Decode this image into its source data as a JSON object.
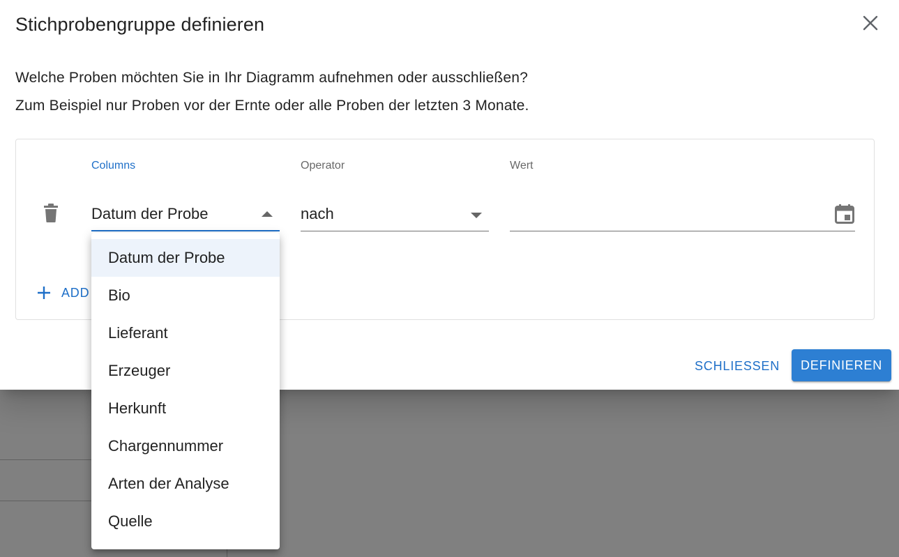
{
  "dialog": {
    "title": "Stichprobengruppe definieren",
    "description_line1": "Welche Proben möchten Sie in Ihr Diagramm aufnehmen oder ausschließen?",
    "description_line2": "Zum Beispiel nur Proben vor der Ernte oder alle Proben der letzten 3 Monate."
  },
  "filter": {
    "labels": {
      "columns": "Columns",
      "operator": "Operator",
      "value": "Wert"
    },
    "row": {
      "column_value": "Datum der Probe",
      "operator_value": "nach",
      "date_value": ""
    },
    "add_label": "ADD"
  },
  "menu": {
    "items": [
      "Datum der Probe",
      "Bio",
      "Lieferant",
      "Erzeuger",
      "Herkunft",
      "Chargennummer",
      "Arten der Analyse",
      "Quelle"
    ],
    "selected_index": 0
  },
  "actions": {
    "close_label": "SCHLIESSEN",
    "define_label": "DEFINIEREN"
  },
  "colors": {
    "accent": "#1e6fc8",
    "primary_button": "#2d7fd3",
    "selected_item_bg": "#edf3fb"
  },
  "icons": {
    "close": "close-icon",
    "delete": "trash-icon",
    "calendar": "calendar-icon",
    "add": "plus-icon"
  }
}
